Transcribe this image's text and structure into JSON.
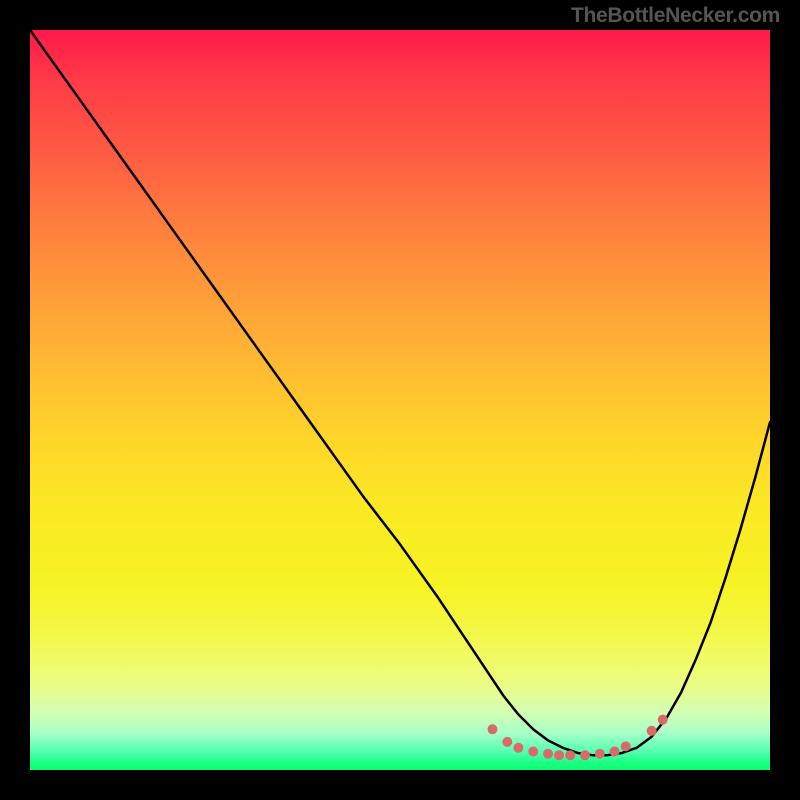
{
  "attribution": "TheBottleNecker.com",
  "chart_data": {
    "type": "line",
    "title": "",
    "xlabel": "",
    "ylabel": "",
    "x_range": [
      0,
      100
    ],
    "y_range": [
      0,
      100
    ],
    "series": [
      {
        "name": "bottleneck-curve",
        "x": [
          0,
          5,
          10,
          15,
          20,
          25,
          30,
          35,
          40,
          45,
          50,
          55,
          58,
          60,
          62,
          64,
          66,
          68,
          70,
          72,
          74,
          76,
          78,
          80,
          82,
          84,
          86,
          88,
          90,
          92,
          94,
          96,
          98,
          100
        ],
        "y": [
          100,
          93,
          86,
          79,
          72,
          65,
          58,
          51,
          44,
          37,
          30.5,
          23.5,
          19,
          16,
          13,
          10,
          7.5,
          5.5,
          4,
          3,
          2.3,
          2,
          2,
          2.3,
          3,
          4.5,
          7,
          10.5,
          15,
          20,
          26,
          32.5,
          39.5,
          47
        ]
      }
    ],
    "marker_cluster": {
      "name": "optimal-range-dots",
      "color": "#d96a6a",
      "points": [
        {
          "x": 62.5,
          "y": 5.5
        },
        {
          "x": 64.5,
          "y": 3.8
        },
        {
          "x": 66,
          "y": 3.0
        },
        {
          "x": 68,
          "y": 2.5
        },
        {
          "x": 70,
          "y": 2.2
        },
        {
          "x": 71.5,
          "y": 2.0
        },
        {
          "x": 73,
          "y": 2.0
        },
        {
          "x": 75,
          "y": 2.0
        },
        {
          "x": 77,
          "y": 2.2
        },
        {
          "x": 79,
          "y": 2.5
        },
        {
          "x": 80.5,
          "y": 3.2
        },
        {
          "x": 84,
          "y": 5.3
        },
        {
          "x": 85.5,
          "y": 6.8
        }
      ],
      "radius": 5
    },
    "gradient_stops": [
      {
        "pos": 0,
        "color": "#ff1a4a"
      },
      {
        "pos": 50,
        "color": "#ffd52a"
      },
      {
        "pos": 85,
        "color": "#f3f84a"
      },
      {
        "pos": 100,
        "color": "#0bff6a"
      }
    ]
  }
}
